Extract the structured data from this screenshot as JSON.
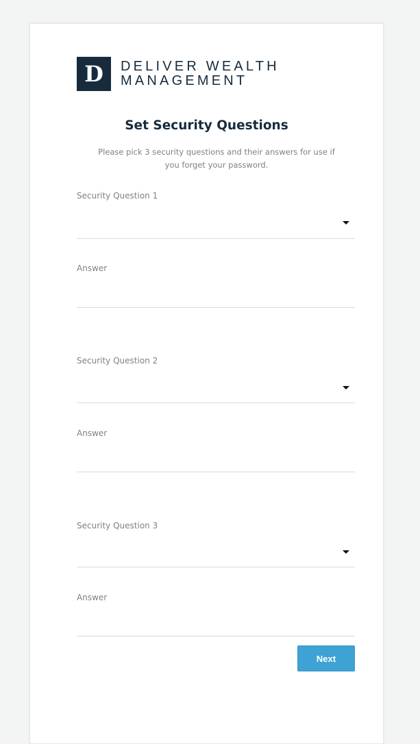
{
  "logo": {
    "mark": "D",
    "line1": "DELIVER WEALTH",
    "line2": "MANAGEMENT"
  },
  "header": {
    "title": "Set Security Questions",
    "subtitle_line1": "Please pick 3 security questions and their answers for use if",
    "subtitle_line2": "you forget your password."
  },
  "form": {
    "questions": [
      {
        "label": "Security Question 1",
        "selected": "",
        "answer_label": "Answer",
        "answer_value": ""
      },
      {
        "label": "Security Question 2",
        "selected": "",
        "answer_label": "Answer",
        "answer_value": ""
      },
      {
        "label": "Security Question 3",
        "selected": "",
        "answer_label": "Answer",
        "answer_value": ""
      }
    ]
  },
  "actions": {
    "next_label": "Next"
  },
  "colors": {
    "brand_navy": "#172b3d",
    "accent_blue": "#3ea3d4"
  },
  "icons": {
    "dropdown": "caret-down-icon"
  }
}
